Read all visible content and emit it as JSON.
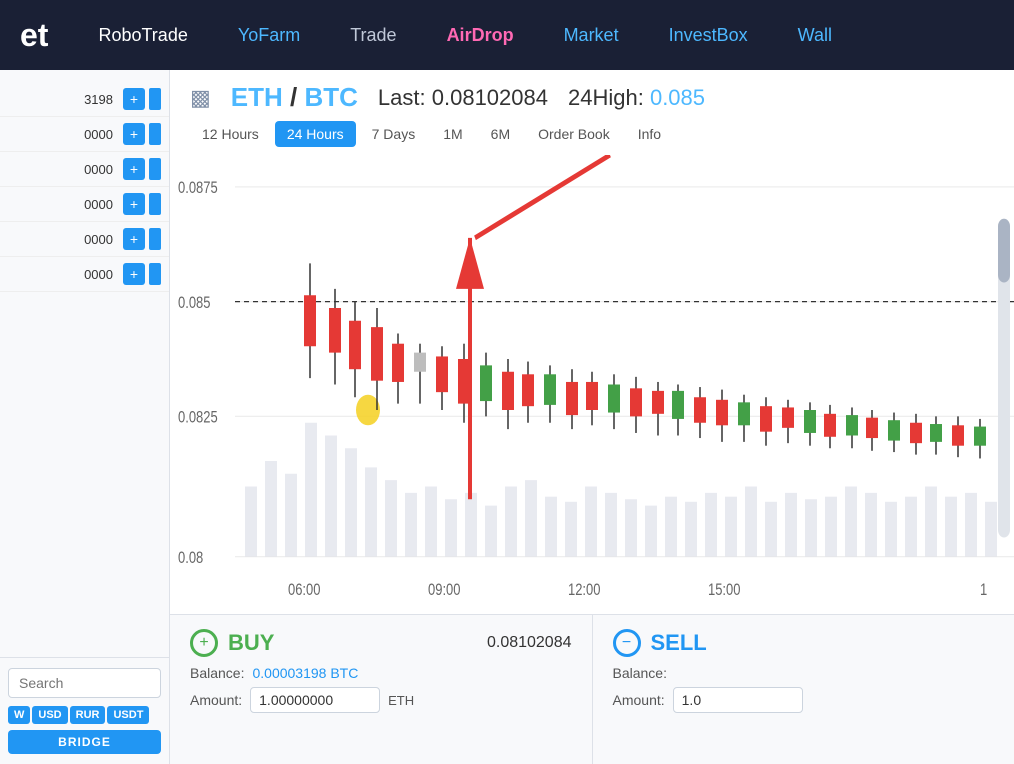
{
  "nav": {
    "logo": "et",
    "items": [
      {
        "label": "RoboTrade",
        "class": "robotrade"
      },
      {
        "label": "YoFarm",
        "class": "yofarm"
      },
      {
        "label": "Trade",
        "class": "trade"
      },
      {
        "label": "AirDrop",
        "class": "airdrop"
      },
      {
        "label": "Market",
        "class": "market"
      },
      {
        "label": "InvestBox",
        "class": "investbox"
      },
      {
        "label": "Wall",
        "class": "wall"
      }
    ]
  },
  "sidebar": {
    "rows": [
      {
        "value": "3198"
      },
      {
        "value": "0000"
      },
      {
        "value": "0000"
      },
      {
        "value": "0000"
      },
      {
        "value": "0000"
      },
      {
        "value": "0000"
      }
    ],
    "search_placeholder": "Search",
    "currencies": [
      "W",
      "USD",
      "RUR",
      "USDT"
    ],
    "bridge_label": "BRIDGE"
  },
  "chart": {
    "base": "ETH",
    "quote": "BTC",
    "separator": " / ",
    "last_label": "Last:",
    "last_price": "0.08102084",
    "high_label": "24High:",
    "high_price": "0.085",
    "time_tabs": [
      {
        "label": "12 Hours",
        "active": false
      },
      {
        "label": "24 Hours",
        "active": true
      },
      {
        "label": "7 Days",
        "active": false
      },
      {
        "label": "1M",
        "active": false
      },
      {
        "label": "6M",
        "active": false
      },
      {
        "label": "Order Book",
        "active": false
      },
      {
        "label": "Info",
        "active": false
      }
    ],
    "y_labels": [
      "0.0875",
      "0.085",
      "0.0825",
      "0.08"
    ],
    "x_labels": [
      "06:00",
      "09:00",
      "12:00",
      "15:00",
      "1"
    ]
  },
  "trade": {
    "buy": {
      "label": "BUY",
      "price": "0.08102084",
      "balance_label": "Balance:",
      "balance_value": "0.00003198 BTC",
      "amount_label": "Amount:",
      "amount_value": "1.00000000",
      "amount_unit": "ETH"
    },
    "sell": {
      "label": "SELL",
      "balance_label": "Balance:",
      "amount_label": "Amount:",
      "amount_value": "1.0",
      "amount_unit": ""
    }
  }
}
